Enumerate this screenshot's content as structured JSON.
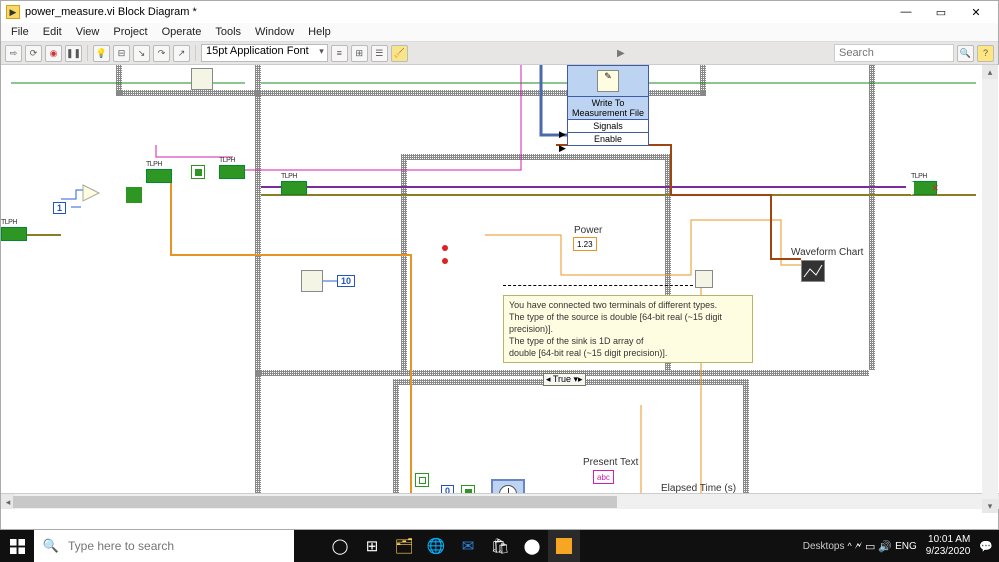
{
  "window": {
    "title": "power_measure.vi Block Diagram *",
    "controls": {
      "min": "—",
      "max": "▭",
      "close": "✕"
    }
  },
  "menu": [
    "File",
    "Edit",
    "View",
    "Project",
    "Operate",
    "Tools",
    "Window",
    "Help"
  ],
  "toolbar": {
    "font": "15pt Application Font",
    "search_arrow": "▶",
    "search_placeholder": "Search"
  },
  "diagram": {
    "shiftreg_label": "TLPH",
    "write_vi": {
      "name": "Write To Measurement File",
      "rows": [
        "Signals",
        "Enable"
      ]
    },
    "constants": {
      "one": "1",
      "ten": "10",
      "zero": "0"
    },
    "labels": {
      "power": "Power",
      "waveform": "Waveform Chart",
      "present": "Present Text",
      "elapsed": "Elapsed Time (s)"
    },
    "case_selector": "◂ True ▾▸",
    "indicators": {
      "numeric": "1.23",
      "string": "abc"
    },
    "error": {
      "line1": "You have connected two terminals of different types.",
      "line2": "The type of the source is double [64-bit real (~15 digit precision)].",
      "line3": "The type of the sink is 1D array of",
      "line4": "  double [64-bit real (~15 digit precision)]."
    }
  },
  "taskbar": {
    "search_placeholder": "Type here to search",
    "desktops": "Desktops",
    "tray_up": "^",
    "lang": "ENG",
    "time": "10:01 AM",
    "date": "9/23/2020"
  }
}
